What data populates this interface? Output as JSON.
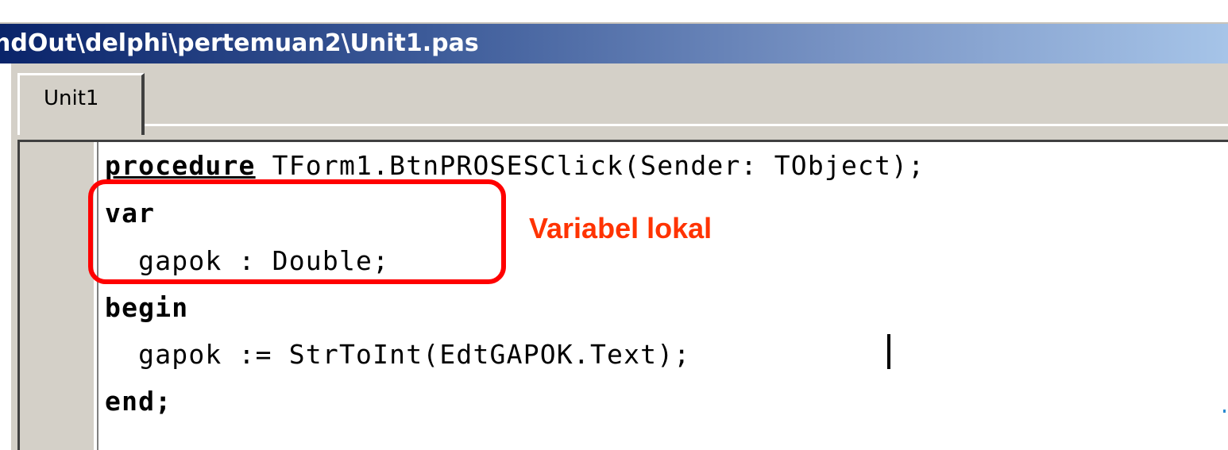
{
  "window": {
    "title": "ndOut\\delphi\\pertemuan2\\Unit1.pas"
  },
  "tabs": [
    {
      "label": "Unit1",
      "active": true
    }
  ],
  "editor": {
    "lines": [
      {
        "keyword": "procedure",
        "rest": " TForm1.BtnPROSESClick(Sender: TObject);"
      },
      {
        "keyword": "var",
        "rest": ""
      },
      {
        "keyword": "",
        "rest": "  gapok : Double;"
      },
      {
        "keyword": "begin",
        "rest": ""
      },
      {
        "keyword": "",
        "rest": "  gapok := StrToInt(EdtGAPOK.Text);"
      },
      {
        "keyword": "end;",
        "rest": ""
      }
    ]
  },
  "annotation": {
    "text": "Variabel lokal",
    "color": "#ff3300",
    "box_color": "#ff0000"
  },
  "colors": {
    "titlebar_start": "#0a246a",
    "titlebar_end": "#a6c4e8",
    "chrome": "#d4d0c8"
  }
}
